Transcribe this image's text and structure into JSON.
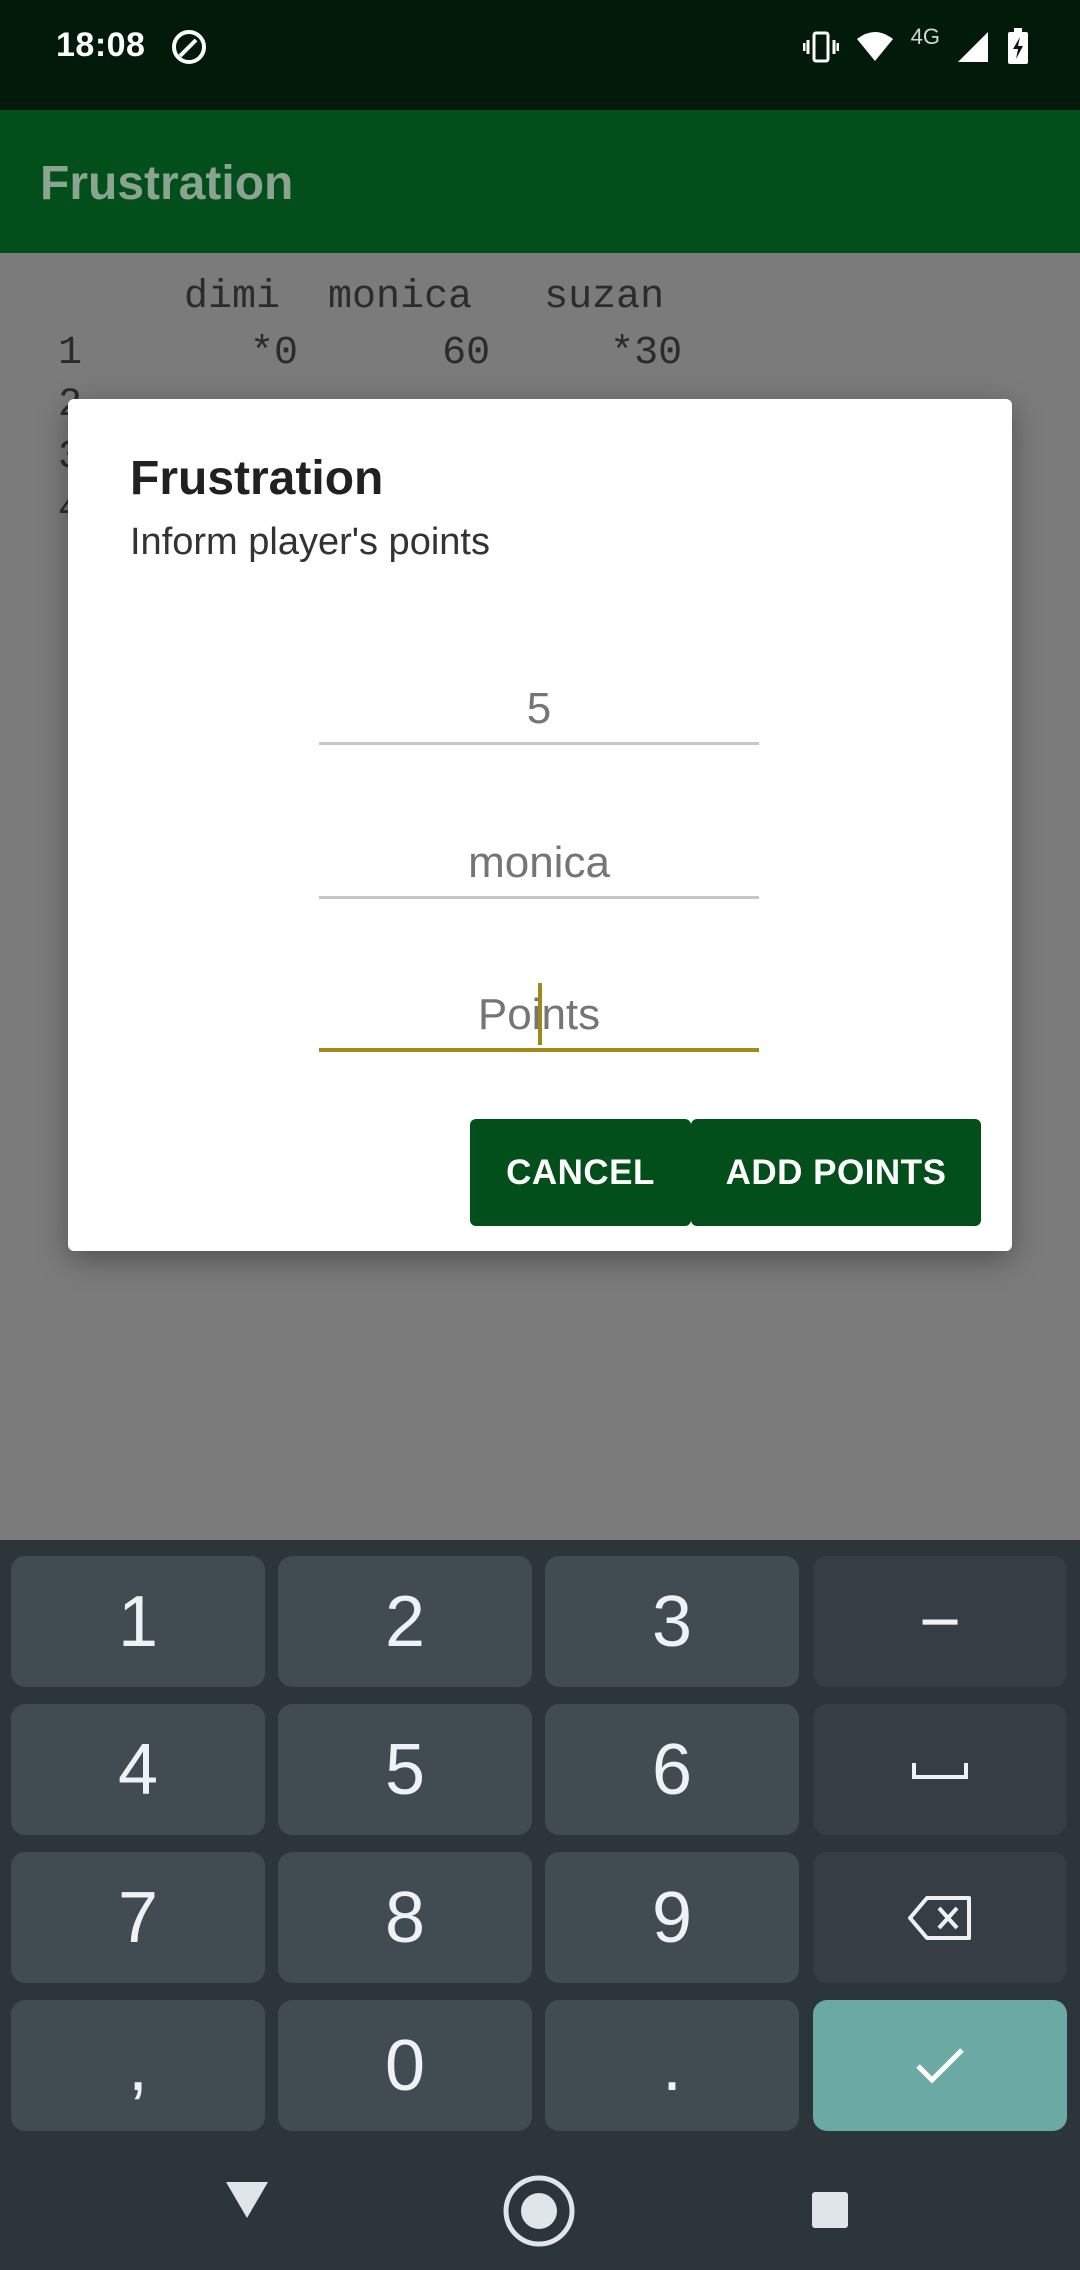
{
  "status_bar": {
    "time": "18:08",
    "network": "4G"
  },
  "app_bar": {
    "title": "Frustration"
  },
  "scoreboard": {
    "header": "      dimi  monica   suzan",
    "rows": [
      "1       *0      60     *30",
      "2",
      "3",
      "4"
    ]
  },
  "dialog": {
    "title": "Frustration",
    "message": "Inform player's points",
    "fields": [
      {
        "placeholder": "5",
        "value": ""
      },
      {
        "placeholder": "monica",
        "value": ""
      },
      {
        "placeholder": "Points",
        "value": ""
      }
    ],
    "cancel_label": "CANCEL",
    "add_label": "ADD POINTS"
  },
  "keyboard": {
    "keys": [
      "1",
      "2",
      "3",
      "−",
      "4",
      "5",
      "6",
      "␣",
      "7",
      "8",
      "9",
      "⌫",
      ",",
      "0",
      ".",
      "✓"
    ]
  },
  "colors": {
    "primary": "#034f1c",
    "status": "#021a0a",
    "accent": "#a08c1c",
    "keyboard": "#2b353a"
  }
}
